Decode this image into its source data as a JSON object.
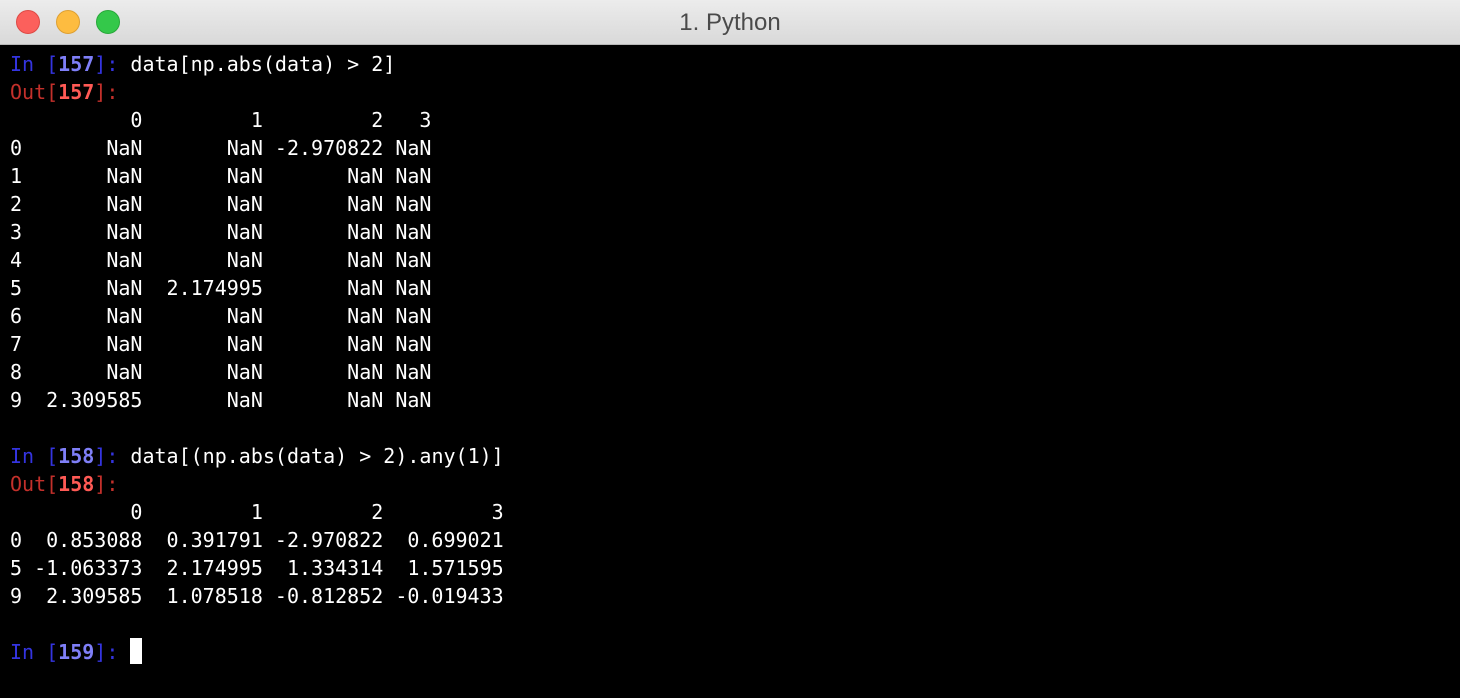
{
  "window": {
    "title": "1. Python"
  },
  "colors": {
    "prompt_in": "#3434e0",
    "prompt_in_number": "#7f7ff8",
    "prompt_out": "#c4302b",
    "prompt_out_number": "#ff5a55",
    "text": "#ffffff",
    "background": "#000000"
  },
  "session": {
    "cell1": {
      "in_label": "In [",
      "in_number": "157",
      "in_close": "]: ",
      "code": "data[np.abs(data) > 2]",
      "out_label": "Out[",
      "out_number": "157",
      "out_close": "]:",
      "table": {
        "header": "          0         1         2   3",
        "rows": [
          "0       NaN       NaN -2.970822 NaN",
          "1       NaN       NaN       NaN NaN",
          "2       NaN       NaN       NaN NaN",
          "3       NaN       NaN       NaN NaN",
          "4       NaN       NaN       NaN NaN",
          "5       NaN  2.174995       NaN NaN",
          "6       NaN       NaN       NaN NaN",
          "7       NaN       NaN       NaN NaN",
          "8       NaN       NaN       NaN NaN",
          "9  2.309585       NaN       NaN NaN"
        ]
      }
    },
    "cell2": {
      "in_label": "In [",
      "in_number": "158",
      "in_close": "]: ",
      "code": "data[(np.abs(data) > 2).any(1)]",
      "out_label": "Out[",
      "out_number": "158",
      "out_close": "]:",
      "table": {
        "header": "          0         1         2         3",
        "rows": [
          "0  0.853088  0.391791 -2.970822  0.699021",
          "5 -1.063373  2.174995  1.334314  1.571595",
          "9  2.309585  1.078518 -0.812852 -0.019433"
        ]
      }
    },
    "cell3": {
      "in_label": "In [",
      "in_number": "159",
      "in_close": "]: "
    }
  }
}
